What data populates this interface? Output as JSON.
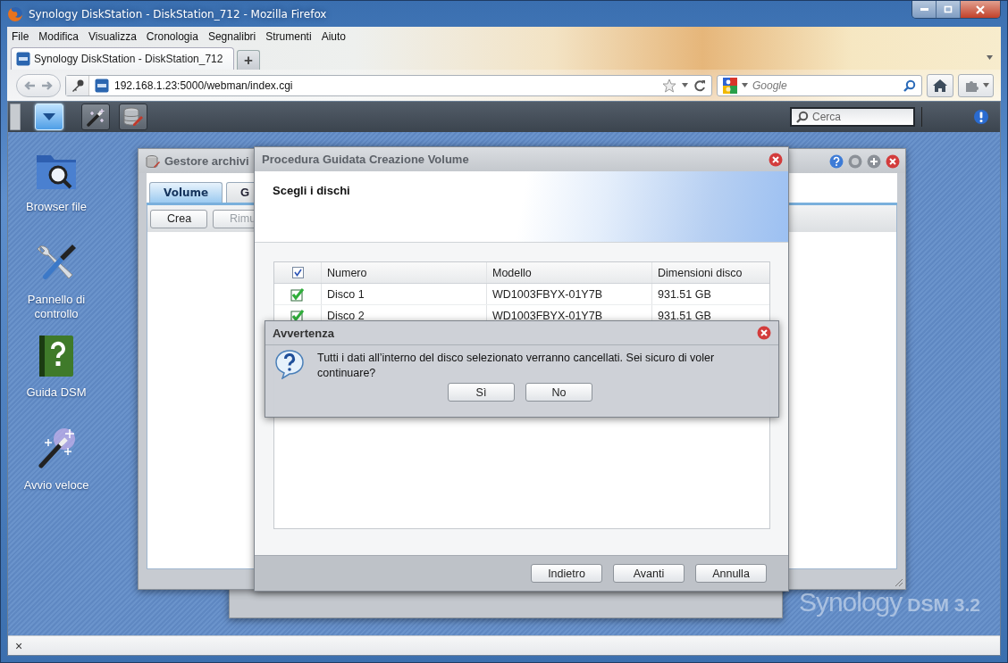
{
  "window": {
    "title": "Synology DiskStation - DiskStation_712 - Mozilla Firefox"
  },
  "menu_bar": [
    "File",
    "Modifica",
    "Visualizza",
    "Cronologia",
    "Segnalibri",
    "Strumenti",
    "Aiuto"
  ],
  "browser_tabs": [
    {
      "title": "Synology DiskStation - DiskStation_712",
      "selected": true
    }
  ],
  "new_tab": "+",
  "address_bar": {
    "value": "192.168.1.23:5000/webman/index.cgi"
  },
  "search_bar": {
    "placeholder": "Google"
  },
  "dsm_taskbar": {
    "buttons": [
      {
        "kind": "menu",
        "selected": true
      },
      {
        "kind": "wizard",
        "selected": false
      },
      {
        "kind": "storage",
        "selected": false
      }
    ],
    "search": {
      "placeholder": "Cerca"
    }
  },
  "desktop_icons": [
    {
      "kind": "folder",
      "label": "Browser file"
    },
    {
      "kind": "tools",
      "label": "Pannello di controllo"
    },
    {
      "kind": "help",
      "label": "Guida DSM"
    },
    {
      "kind": "wizard",
      "label": "Avvio veloce"
    }
  ],
  "storage_window": {
    "title": "Gestore archivi",
    "tabs": [
      {
        "label": "Volume",
        "selected": true
      },
      {
        "label": "G",
        "selected": false
      }
    ],
    "toolbar": [
      {
        "label": "Crea",
        "disabled": false
      },
      {
        "label": "Rimu",
        "disabled": true
      }
    ]
  },
  "wizard": {
    "title": "Procedura Guidata Creazione Volume",
    "step_title": "Scegli i dischi",
    "table": {
      "all_checked": true,
      "columns": [
        "Numero",
        "Modello",
        "Dimensioni disco"
      ],
      "rows": [
        {
          "checked": true,
          "cells": [
            "Disco 1",
            "WD1003FBYX-01Y7B",
            "931.51 GB"
          ]
        },
        {
          "checked": true,
          "cells": [
            "Disco 2",
            "WD1003FBYX-01Y7B",
            "931.51 GB"
          ]
        }
      ]
    },
    "buttons": [
      "Indietro",
      "Avanti",
      "Annulla"
    ]
  },
  "alert": {
    "title": "Avvertenza",
    "message": "Tutti i dati all’interno del disco selezionato verranno cancellati. Sei sicuro di voler continuare?",
    "buttons": [
      "Sì",
      "No"
    ]
  },
  "branding": {
    "brand": "Synology",
    "product": "DSM 3.2"
  },
  "status_bar": {
    "close": "×"
  }
}
